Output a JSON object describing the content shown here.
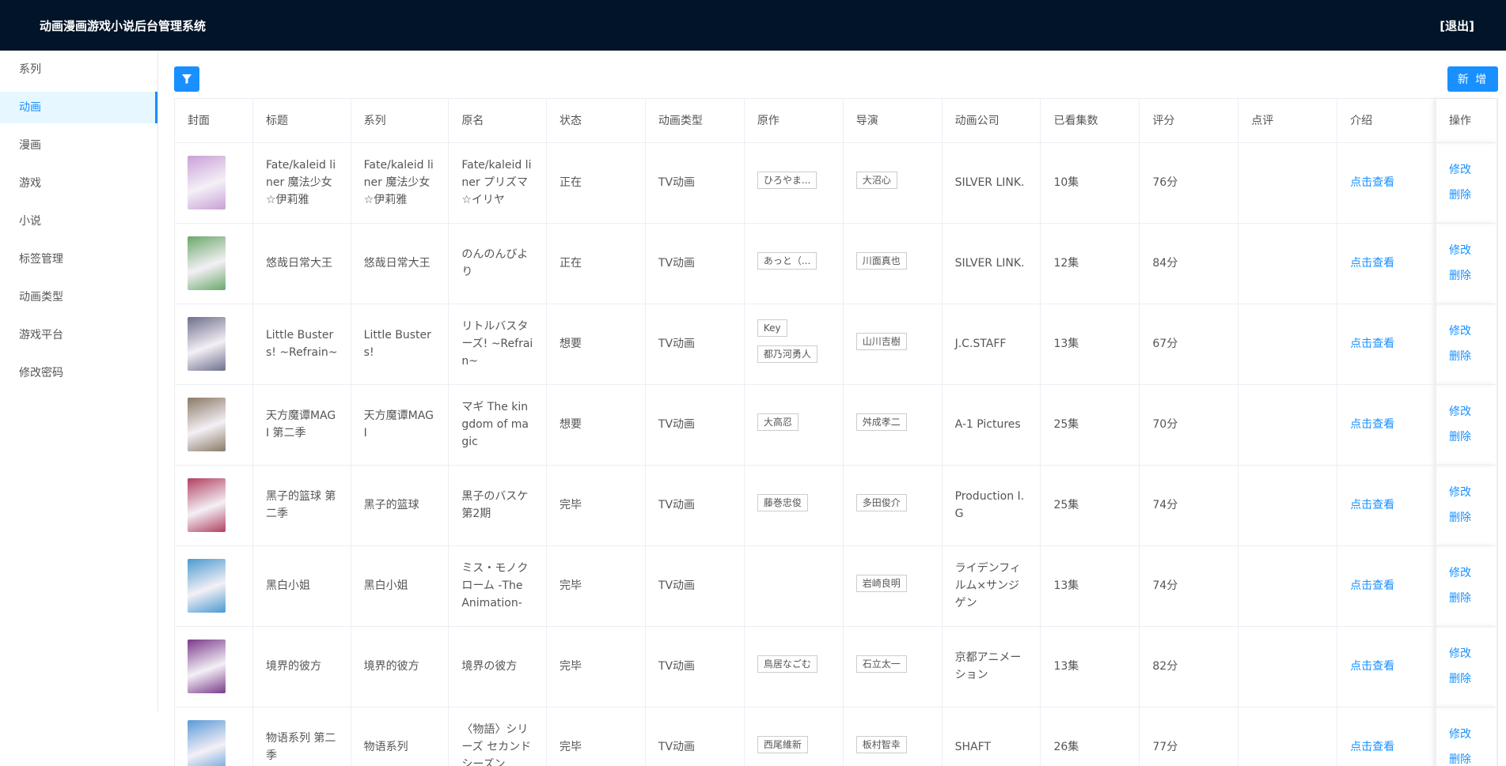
{
  "header": {
    "title": "动画漫画游戏小说后台管理系统",
    "logout": "[退出]"
  },
  "sidebar": {
    "items": [
      {
        "label": "系列"
      },
      {
        "label": "动画"
      },
      {
        "label": "漫画"
      },
      {
        "label": "游戏"
      },
      {
        "label": "小说"
      },
      {
        "label": "标签管理"
      },
      {
        "label": "动画类型"
      },
      {
        "label": "游戏平台"
      },
      {
        "label": "修改密码"
      }
    ]
  },
  "toolbar": {
    "add_label": "新 增"
  },
  "table": {
    "columns": [
      "封面",
      "标题",
      "系列",
      "原名",
      "状态",
      "动画类型",
      "原作",
      "导演",
      "动画公司",
      "已看集数",
      "评分",
      "点评",
      "介绍",
      "操作"
    ],
    "edit_label": "修改",
    "delete_label": "删除",
    "view_label": "点击查看",
    "rows": [
      {
        "title": "Fate/kaleid liner 魔法少女☆伊莉雅",
        "series": "Fate/kaleid liner 魔法少女☆伊莉雅",
        "original": "Fate/kaleid liner プリズマ☆イリヤ",
        "status": "正在",
        "type": "TV动画",
        "author": [
          "ひろやま..."
        ],
        "director": [
          "大沼心"
        ],
        "studio": "SILVER LINK.",
        "episodes": "10集",
        "score": "76分",
        "review": "",
        "cover": "#c9a0d8"
      },
      {
        "title": "悠哉日常大王",
        "series": "悠哉日常大王",
        "original": "のんのんびより",
        "status": "正在",
        "type": "TV动画",
        "author": [
          "あっと（..."
        ],
        "director": [
          "川面真也"
        ],
        "studio": "SILVER LINK.",
        "episodes": "12集",
        "score": "84分",
        "review": "",
        "cover": "#6aa86a"
      },
      {
        "title": "Little Busters! ~Refrain~",
        "series": "Little Busters!",
        "original": "リトルバスターズ! ~Refrain~",
        "status": "想要",
        "type": "TV动画",
        "author": [
          "Key",
          "都乃河勇人"
        ],
        "director": [
          "山川吉樹"
        ],
        "studio": "J.C.STAFF",
        "episodes": "13集",
        "score": "67分",
        "review": "",
        "cover": "#6d6f8c"
      },
      {
        "title": "天方魔谭MAGI 第二季",
        "series": "天方魔谭MAGI",
        "original": "マギ The kingdom of magic",
        "status": "想要",
        "type": "TV动画",
        "author": [
          "大高忍"
        ],
        "director": [
          "舛成孝二"
        ],
        "studio": "A-1 Pictures",
        "episodes": "25集",
        "score": "70分",
        "review": "",
        "cover": "#8a7a66"
      },
      {
        "title": "黑子的篮球 第二季",
        "series": "黑子的篮球",
        "original": "黒子のバスケ 第2期",
        "status": "完毕",
        "type": "TV动画",
        "author": [
          "藤巻忠俊"
        ],
        "director": [
          "多田俊介"
        ],
        "studio": "Production I.G",
        "episodes": "25集",
        "score": "74分",
        "review": "",
        "cover": "#b04060"
      },
      {
        "title": "黑白小姐",
        "series": "黑白小姐",
        "original": "ミス・モノクローム -The Animation-",
        "status": "完毕",
        "type": "TV动画",
        "author": [],
        "director": [
          "岩崎良明"
        ],
        "studio": "ライデンフィルム×サンジゲン",
        "episodes": "13集",
        "score": "74分",
        "review": "",
        "cover": "#4a9ad0"
      },
      {
        "title": "境界的彼方",
        "series": "境界的彼方",
        "original": "境界の彼方",
        "status": "完毕",
        "type": "TV动画",
        "author": [
          "鳥居なごむ"
        ],
        "director": [
          "石立太一"
        ],
        "studio": "京都アニメーション",
        "episodes": "13集",
        "score": "82分",
        "review": "",
        "cover": "#7a3a8a"
      },
      {
        "title": "物语系列 第二季",
        "series": "物语系列",
        "original": "〈物語〉シリーズ セカンドシーズン",
        "status": "完毕",
        "type": "TV动画",
        "author": [
          "西尾維新"
        ],
        "director": [
          "板村智幸"
        ],
        "studio": "SHAFT",
        "episodes": "26集",
        "score": "77分",
        "review": "",
        "cover": "#5a9ad8"
      }
    ]
  }
}
